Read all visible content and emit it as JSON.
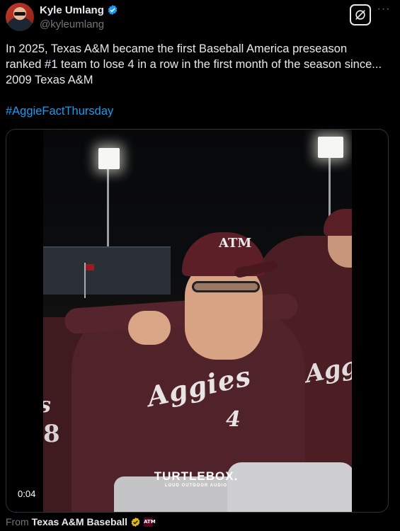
{
  "author": {
    "display_name": "Kyle Umlang",
    "handle": "@kyleumlang",
    "verified_icon": "blue-check-icon"
  },
  "actions": {
    "grok_icon": "grok-icon",
    "more_label": "···"
  },
  "tweet": {
    "text_lines": [
      "In 2025, Texas A&M became the first Baseball America preseason",
      "ranked #1 team to lose 4 in a row in the first month of the season since...",
      "2009 Texas A&M"
    ],
    "hashtag": "#AggieFactThursday"
  },
  "media": {
    "type": "video",
    "timestamp": "0:04",
    "jersey_text": "Aggies",
    "jersey_number": "4",
    "jersey_text_right": "Agg",
    "jersey_text_left": "s",
    "jersey_number_left": "8",
    "cap_logo": "ATM",
    "watermark_title": "TURTLEBOX.",
    "watermark_sub": "LOUD OUTDOOR AUDIO"
  },
  "attribution": {
    "from_label": "From",
    "source_name": "Texas A&M Baseball",
    "source_badge": "gold-check-icon",
    "source_logo_text": "ATM"
  },
  "colors": {
    "background": "#000000",
    "text": "#e7e9ea",
    "muted": "#71767b",
    "link": "#1d9bf0",
    "verified_blue": "#1d9bf0",
    "verified_gold": "#e2b719",
    "maroon": "#500000"
  }
}
